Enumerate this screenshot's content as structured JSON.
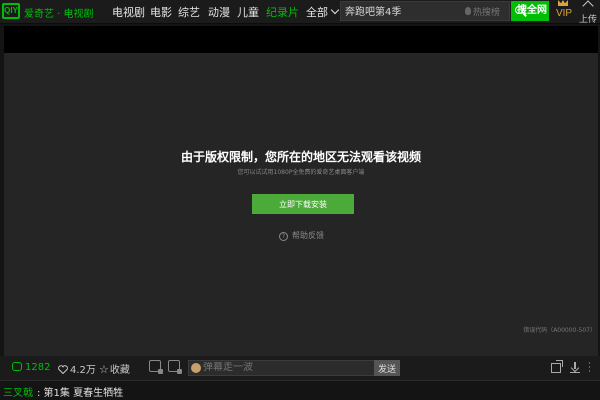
{
  "header": {
    "logo_mark": "QIY",
    "logo_text": "爱奇艺 · 电视剧",
    "nav": [
      {
        "label": "电视剧"
      },
      {
        "label": "电影"
      },
      {
        "label": "综艺"
      },
      {
        "label": "动漫"
      },
      {
        "label": "儿童"
      },
      {
        "label": "纪录片"
      }
    ],
    "all_label": "全部",
    "search_value": "奔跑吧第4季",
    "hot_search_label": "热搜榜",
    "search_button_label": "搜全网",
    "vip_label": "VIP",
    "upload_label": "上传"
  },
  "player": {
    "message_title": "由于版权限制，您所在的地区无法观看该视频",
    "message_sub": "您可以试试用1080P全免费的爱奇艺桌面客户端",
    "install_button": "立即下载安装",
    "help_label": "帮助反馈",
    "error_code": "错误代码（A00000-507）"
  },
  "controls": {
    "comment_count": "1282",
    "like_count": "4.2万",
    "favorite_label": "收藏",
    "danmu_placeholder": "弹幕走一波",
    "send_label": "发送"
  },
  "episode": {
    "show": "三叉戟",
    "title": ": 第1集 夏春生牺牲"
  },
  "colors": {
    "brand_green": "#00be06",
    "button_green": "#4caa3a",
    "vip_gold": "#d9a53b"
  }
}
